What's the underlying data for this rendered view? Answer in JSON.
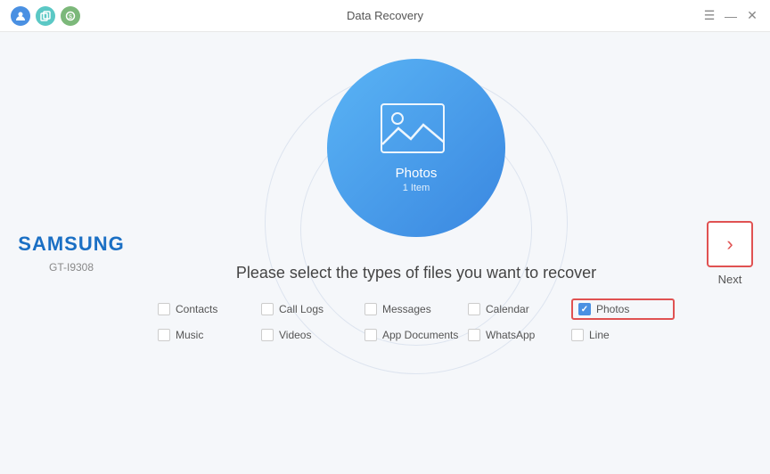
{
  "titleBar": {
    "title": "Data Recovery",
    "icons": [
      {
        "name": "person-icon",
        "symbol": "👤"
      },
      {
        "name": "copy-icon",
        "symbol": "⧉"
      },
      {
        "name": "shield-icon",
        "symbol": "⊕"
      }
    ],
    "controls": {
      "menu": "☰",
      "minimize": "—",
      "close": "✕"
    }
  },
  "leftPanel": {
    "brand": "SAMSUNG",
    "deviceId": "GT-I9308"
  },
  "center": {
    "featureLabel": "Photos",
    "featureCount": "1 Item",
    "instruction": "Please select the types of files you want to recover",
    "checkboxes": [
      {
        "id": "contacts",
        "label": "Contacts",
        "checked": false
      },
      {
        "id": "callLogs",
        "label": "Call Logs",
        "checked": false
      },
      {
        "id": "messages",
        "label": "Messages",
        "checked": false
      },
      {
        "id": "calendar",
        "label": "Calendar",
        "checked": false
      },
      {
        "id": "photos",
        "label": "Photos",
        "checked": true
      },
      {
        "id": "music",
        "label": "Music",
        "checked": false
      },
      {
        "id": "videos",
        "label": "Videos",
        "checked": false
      },
      {
        "id": "appDocuments",
        "label": "App Documents",
        "checked": false
      },
      {
        "id": "whatsapp",
        "label": "WhatsApp",
        "checked": false
      },
      {
        "id": "line",
        "label": "Line",
        "checked": false
      }
    ]
  },
  "rightPanel": {
    "nextLabel": "Next"
  }
}
